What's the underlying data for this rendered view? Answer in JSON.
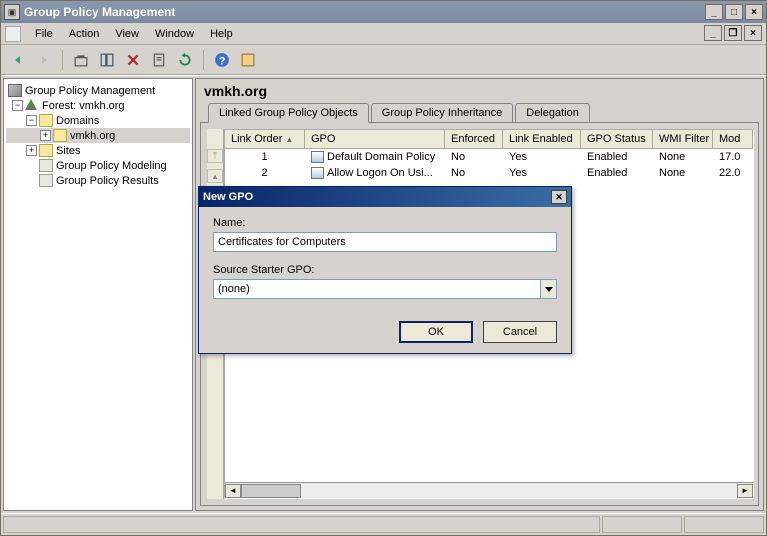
{
  "window": {
    "title": "Group Policy Management"
  },
  "menu": {
    "file": "File",
    "action": "Action",
    "view": "View",
    "window": "Window",
    "help": "Help"
  },
  "tree": {
    "root": "Group Policy Management",
    "forest": "Forest: vmkh.org",
    "domains": "Domains",
    "domain1": "vmkh.org",
    "sites": "Sites",
    "modeling": "Group Policy Modeling",
    "results": "Group Policy Results"
  },
  "content": {
    "title": "vmkh.org",
    "tabs": {
      "linked": "Linked Group Policy Objects",
      "inheritance": "Group Policy Inheritance",
      "delegation": "Delegation"
    },
    "columns": {
      "linkorder": "Link Order",
      "gpo": "GPO",
      "enforced": "Enforced",
      "linkenabled": "Link Enabled",
      "gpostatus": "GPO Status",
      "wmifilter": "WMI Filter",
      "modified": "Mod"
    },
    "rows": [
      {
        "order": "1",
        "gpo": "Default Domain Policy",
        "enforced": "No",
        "linkenabled": "Yes",
        "status": "Enabled",
        "wmi": "None",
        "mod": "17.0"
      },
      {
        "order": "2",
        "gpo": "Allow Logon On Usi...",
        "enforced": "No",
        "linkenabled": "Yes",
        "status": "Enabled",
        "wmi": "None",
        "mod": "22.0"
      }
    ]
  },
  "dialog": {
    "title": "New GPO",
    "name_label": "Name:",
    "name_value": "Certificates for Computers",
    "starter_label": "Source Starter GPO:",
    "starter_value": "(none)",
    "ok": "OK",
    "cancel": "Cancel"
  }
}
